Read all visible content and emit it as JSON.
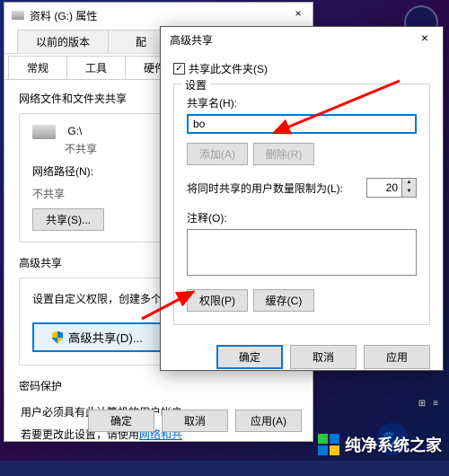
{
  "win1": {
    "title": "资料 (G:) 属性",
    "tabs_top": {
      "prev_versions": "以前的版本",
      "quota": "配"
    },
    "tabs_bottom": {
      "general": "常规",
      "tools": "工具",
      "hardware": "硬件"
    },
    "section1": {
      "header": "网络文件和文件夹共享",
      "drive": "G:\\",
      "status": "不共享",
      "path_label": "网络路径(N):",
      "path_value": "不共享",
      "share_btn": "共享(S)..."
    },
    "section2": {
      "header": "高级共享",
      "desc": "设置自定义权限，创建多个共享",
      "btn": "高级共享(D)..."
    },
    "section3": {
      "header": "密码保护",
      "line1": "用户必须具有此计算机的用户帐户",
      "line2_a": "若要更改此设置，请使用",
      "line2_link": "网络和共"
    },
    "ok": "确定",
    "cancel": "取消",
    "apply": "应用(A)"
  },
  "win2": {
    "title": "高级共享",
    "share_checkbox": "共享此文件夹(S)",
    "settings_legend": "设置",
    "sharename_label": "共享名(H):",
    "sharename_value": "bo",
    "add_btn": "添加(A)",
    "remove_btn": "删除(R)",
    "limit_label": "将同时共享的用户数量限制为(L):",
    "limit_value": "20",
    "comment_label": "注释(O):",
    "comment_value": "",
    "perm_btn": "权限(P)",
    "cache_btn": "缓存(C)",
    "ok": "确定",
    "cancel": "取消",
    "apply": "应用"
  },
  "watermark": "纯净系统之家",
  "status": {
    "grid": "⊞",
    "list": "≡"
  }
}
